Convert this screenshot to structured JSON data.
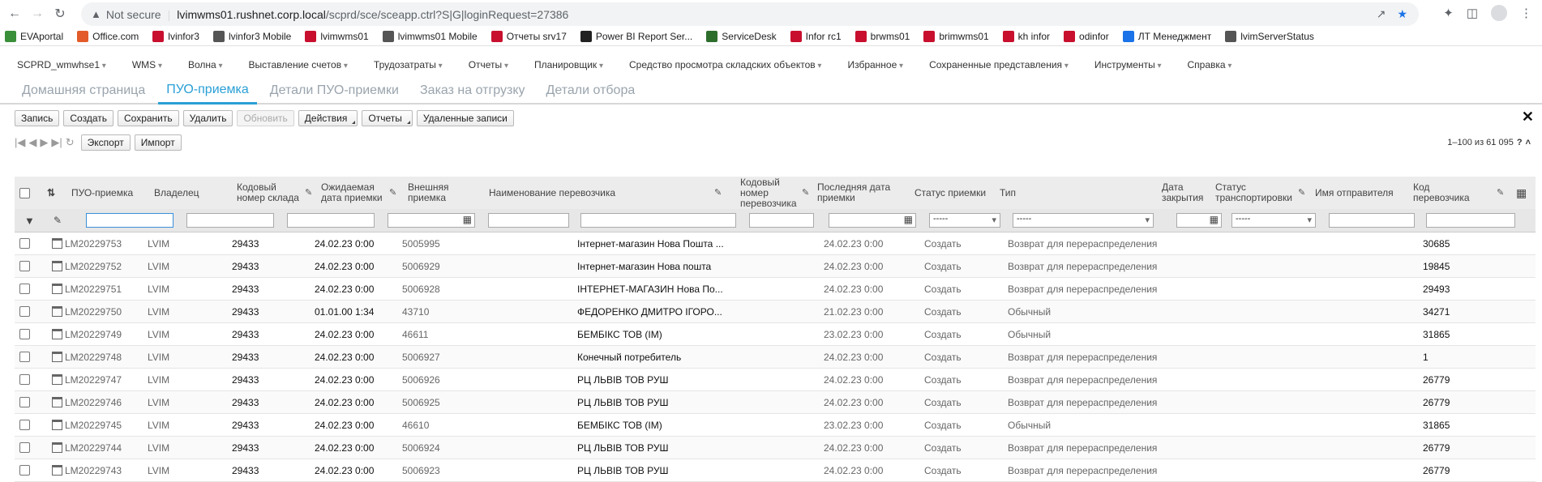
{
  "browser": {
    "security_label": "Not secure",
    "url_host": "lvimwms01.rushnet.corp.local",
    "url_path": "/scprd/sce/sceapp.ctrl?S|G|loginRequest=27386"
  },
  "bookmarks": [
    {
      "label": "EVAportal",
      "color": "#3a8f3a"
    },
    {
      "label": "Office.com",
      "color": "#e35b2a"
    },
    {
      "label": "lvinfor3",
      "color": "#c8102e"
    },
    {
      "label": "lvinfor3 Mobile",
      "color": "#555555"
    },
    {
      "label": "lvimwms01",
      "color": "#c8102e"
    },
    {
      "label": "lvimwms01 Mobile",
      "color": "#555555"
    },
    {
      "label": "Отчеты srv17",
      "color": "#c8102e"
    },
    {
      "label": "Power BI Report Ser...",
      "color": "#222222"
    },
    {
      "label": "ServiceDesk",
      "color": "#2d6e2d"
    },
    {
      "label": "Infor rc1",
      "color": "#c8102e"
    },
    {
      "label": "brwms01",
      "color": "#c8102e"
    },
    {
      "label": "brimwms01",
      "color": "#c8102e"
    },
    {
      "label": "kh infor",
      "color": "#c8102e"
    },
    {
      "label": "odinfor",
      "color": "#c8102e"
    },
    {
      "label": "ЛТ Менеджмент",
      "color": "#1a73e8"
    },
    {
      "label": "lvimServerStatus",
      "color": "#555555"
    }
  ],
  "app_menu": [
    "SCPRD_wmwhse1",
    "WMS",
    "Волна",
    "Выставление счетов",
    "Трудозатраты",
    "Отчеты",
    "Планировщик",
    "Средство просмотра складских объектов",
    "Избранное",
    "Сохраненные представления",
    "Инструменты",
    "Справка"
  ],
  "tabs": [
    {
      "label": "Домашняя страница",
      "active": false
    },
    {
      "label": "ПУО-приемка",
      "active": true
    },
    {
      "label": "Детали ПУО-приемки",
      "active": false
    },
    {
      "label": "Заказ на отгрузку",
      "active": false
    },
    {
      "label": "Детали отбора",
      "active": false
    }
  ],
  "toolbar": {
    "record": "Запись",
    "create": "Создать",
    "save": "Сохранить",
    "delete": "Удалить",
    "refresh": "Обновить",
    "actions": "Действия",
    "reports": "Отчеты",
    "deleted": "Удаленные записи"
  },
  "pager": {
    "export": "Экспорт",
    "import": "Импорт",
    "count": "1–100 из 61 095"
  },
  "columns": {
    "receipt": "ПУО-приемка",
    "owner": "Владелец",
    "wh_code": "Кодовый номер склада",
    "expected": "Ожидаемая дата приемки",
    "ext_receipt": "Внешняя приемка",
    "carrier_name": "Наименование перевозчика",
    "carrier_code_no": "Кодовый номер перевозчика",
    "last_date": "Последняя дата приемки",
    "status": "Статус приемки",
    "type": "Тип",
    "close_date": "Дата закрытия",
    "transport_status": "Статус транспортировки",
    "sender": "Имя отправителя",
    "carrier_code": "Код перевозчика"
  },
  "filters": {
    "status": "-----",
    "type": "-----",
    "transport_status": "-----"
  },
  "rows": [
    {
      "id": "LM20229753",
      "owner": "LVIM",
      "wh": "29433",
      "expected": "24.02.23 0:00",
      "ext": "5005995",
      "carrier": "Інтернет-магазин Нова Пошта ...",
      "last": "24.02.23 0:00",
      "status": "Создать",
      "type": "Возврат для перераспределения",
      "code": "30685"
    },
    {
      "id": "LM20229752",
      "owner": "LVIM",
      "wh": "29433",
      "expected": "24.02.23 0:00",
      "ext": "5006929",
      "carrier": "Інтернет-магазин Нова пошта",
      "last": "24.02.23 0:00",
      "status": "Создать",
      "type": "Возврат для перераспределения",
      "code": "19845"
    },
    {
      "id": "LM20229751",
      "owner": "LVIM",
      "wh": "29433",
      "expected": "24.02.23 0:00",
      "ext": "5006928",
      "carrier": "ІНТЕРНЕТ-МАГАЗИН Нова По...",
      "last": "24.02.23 0:00",
      "status": "Создать",
      "type": "Возврат для перераспределения",
      "code": "29493"
    },
    {
      "id": "LM20229750",
      "owner": "LVIM",
      "wh": "29433",
      "expected": "01.01.00 1:34",
      "ext": "43710",
      "carrier": "ФЕДОРЕНКО ДМИТРО ІГОРО...",
      "last": "21.02.23 0:00",
      "status": "Создать",
      "type": "Обычный",
      "code": "34271"
    },
    {
      "id": "LM20229749",
      "owner": "LVIM",
      "wh": "29433",
      "expected": "24.02.23 0:00",
      "ext": "46611",
      "carrier": "БЕМБІКС ТОВ (ІМ)",
      "last": "23.02.23 0:00",
      "status": "Создать",
      "type": "Обычный",
      "code": "31865"
    },
    {
      "id": "LM20229748",
      "owner": "LVIM",
      "wh": "29433",
      "expected": "24.02.23 0:00",
      "ext": "5006927",
      "carrier": "Конечный потребитель",
      "last": "24.02.23 0:00",
      "status": "Создать",
      "type": "Возврат для перераспределения",
      "code": "1"
    },
    {
      "id": "LM20229747",
      "owner": "LVIM",
      "wh": "29433",
      "expected": "24.02.23 0:00",
      "ext": "5006926",
      "carrier": "РЦ ЛЬВІВ ТОВ РУШ",
      "last": "24.02.23 0:00",
      "status": "Создать",
      "type": "Возврат для перераспределения",
      "code": "26779"
    },
    {
      "id": "LM20229746",
      "owner": "LVIM",
      "wh": "29433",
      "expected": "24.02.23 0:00",
      "ext": "5006925",
      "carrier": "РЦ ЛЬВІВ ТОВ РУШ",
      "last": "24.02.23 0:00",
      "status": "Создать",
      "type": "Возврат для перераспределения",
      "code": "26779"
    },
    {
      "id": "LM20229745",
      "owner": "LVIM",
      "wh": "29433",
      "expected": "24.02.23 0:00",
      "ext": "46610",
      "carrier": "БЕМБІКС ТОВ (ІМ)",
      "last": "23.02.23 0:00",
      "status": "Создать",
      "type": "Обычный",
      "code": "31865"
    },
    {
      "id": "LM20229744",
      "owner": "LVIM",
      "wh": "29433",
      "expected": "24.02.23 0:00",
      "ext": "5006924",
      "carrier": "РЦ ЛЬВІВ ТОВ РУШ",
      "last": "24.02.23 0:00",
      "status": "Создать",
      "type": "Возврат для перераспределения",
      "code": "26779"
    },
    {
      "id": "LM20229743",
      "owner": "LVIM",
      "wh": "29433",
      "expected": "24.02.23 0:00",
      "ext": "5006923",
      "carrier": "РЦ ЛЬВІВ ТОВ РУШ",
      "last": "24.02.23 0:00",
      "status": "Создать",
      "type": "Возврат для перераспределения",
      "code": "26779"
    }
  ]
}
